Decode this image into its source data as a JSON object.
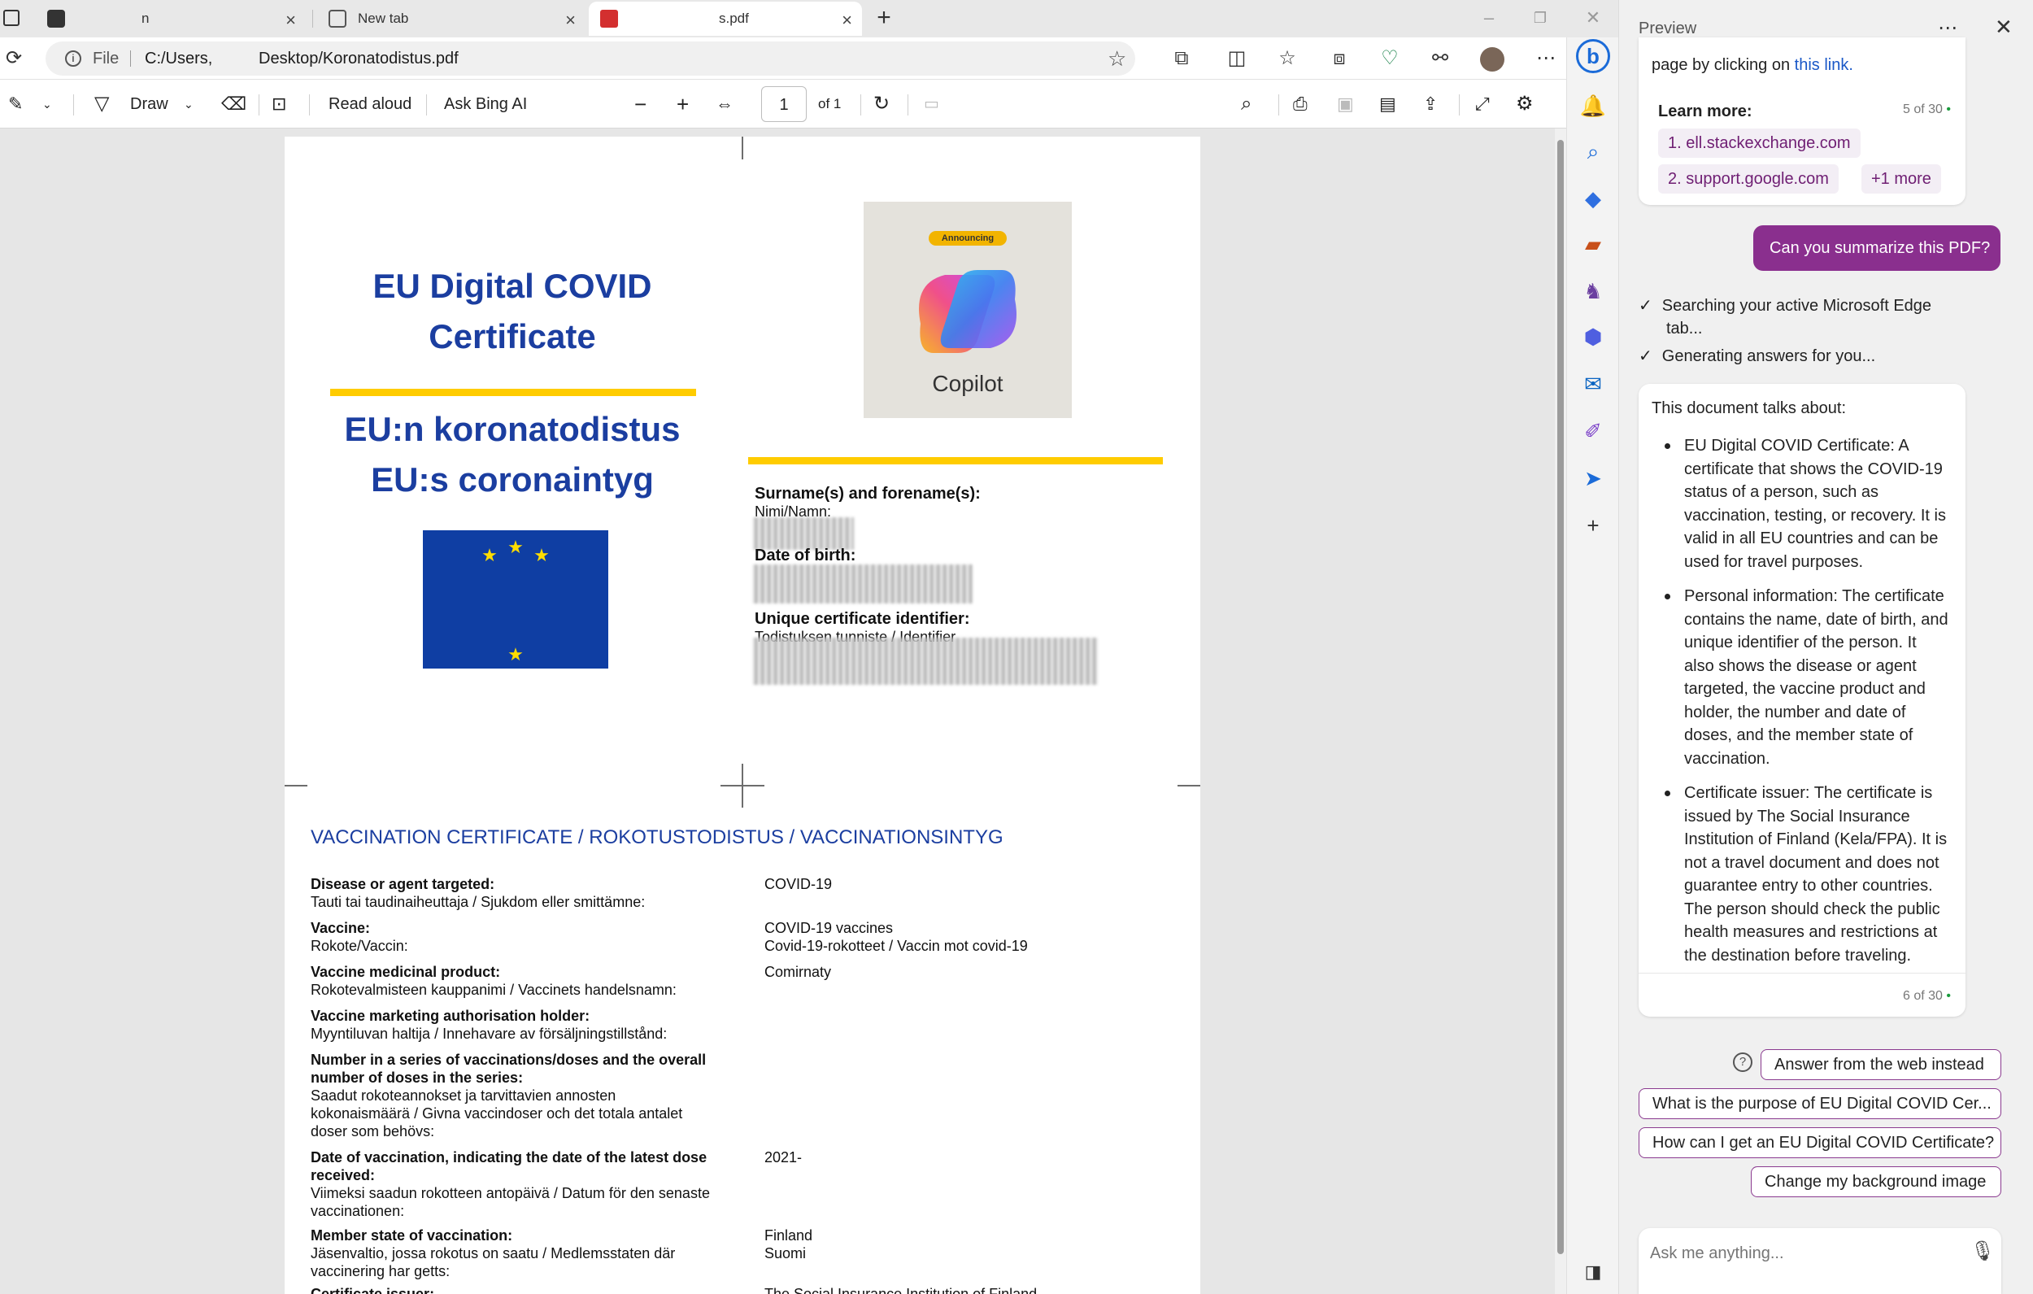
{
  "browser": {
    "tabs": [
      {
        "label": "n"
      },
      {
        "label": "New tab"
      },
      {
        "label": "s.pdf"
      }
    ],
    "address": {
      "scheme_label": "File",
      "path_start": "C:/Users,",
      "path_end": "Desktop/Koronatodistus.pdf"
    }
  },
  "pdf_toolbar": {
    "draw": "Draw",
    "read_aloud": "Read aloud",
    "ask_bing": "Ask Bing AI",
    "page_number": "1",
    "page_of": "of 1"
  },
  "pdf": {
    "title_line1": "EU Digital COVID",
    "title_line2": "Certificate",
    "fi_title": "EU:n koronatodistus",
    "sv_title": "EU:s coronaintyg",
    "copilot_badge": "Announcing",
    "copilot_label": "Copilot",
    "personal": {
      "surname_label": "Surname(s) and forename(s):",
      "surname_sub": "Nimi/Namn:",
      "dob_label": "Date of birth:",
      "uci_label": "Unique certificate identifier:",
      "uci_sub": "Todistuksen tunniste / Identifier"
    },
    "vaccination_header": "VACCINATION CERTIFICATE / ROKOTUSTODISTUS / VACCINATIONSINTYG",
    "rows": [
      {
        "label": "Disease or agent targeted:",
        "sub": "Tauti tai taudinaiheuttaja / Sjukdom eller smittämne:",
        "value": "COVID-19",
        "value2": ""
      },
      {
        "label": "Vaccine:",
        "sub": "Rokote/Vaccin:",
        "value": "COVID-19 vaccines",
        "value2": "Covid-19-rokotteet / Vaccin mot covid-19"
      },
      {
        "label": "Vaccine medicinal product:",
        "sub": "Rokotevalmisteen kauppanimi / Vaccinets handelsnamn:",
        "value": "Comirnaty",
        "value2": ""
      },
      {
        "label": "Vaccine marketing authorisation holder:",
        "sub": "Myyntiluvan haltija / Innehavare av försäljningstillstånd:",
        "value": "",
        "value2": ""
      },
      {
        "label": "Number in a series of vaccinations/doses and the overall",
        "label2": "number of doses in the series:",
        "sub": "Saadut rokoteannokset ja tarvittavien annosten",
        "sub2": "kokonaismäärä / Givna vaccindoser och det totala antalet",
        "sub3": "doser som behövs:",
        "value": "",
        "value2": ""
      },
      {
        "label": "Date of vaccination, indicating the date of the latest dose",
        "label2": "received:",
        "sub": "Viimeksi saadun rokotteen antopäivä / Datum för den senaste",
        "sub2": "vaccinationen:",
        "value": "2021-",
        "value2": ""
      },
      {
        "label": "Member state of vaccination:",
        "sub": "Jäsenvaltio, jossa rokotus on saatu / Medlemsstaten där",
        "sub2": "vaccinering har getts:",
        "value": "Finland",
        "value2": "Suomi"
      },
      {
        "label": "Certificate issuer:",
        "sub": "",
        "value": "The Social Insurance Institution of Finland",
        "value2": ""
      }
    ]
  },
  "copilot": {
    "header": "Preview",
    "prev_text": "page by clicking on",
    "prev_link": "this link.",
    "learn_more": "Learn more:",
    "counter1": "5 of 30",
    "sources": [
      "1. ell.stackexchange.com",
      "2. support.google.com",
      "+1 more"
    ],
    "user_msg": "Can you summarize this PDF?",
    "status1a": "Searching your active Microsoft Edge",
    "status1b": "tab...",
    "status2": "Generating answers for you...",
    "answer_intro": "This document talks about:",
    "bullets": [
      [
        "EU Digital COVID Certificate: A",
        "certificate that shows the COVID-19",
        "status of a person, such as",
        "vaccination, testing, or recovery. It is",
        "valid in all EU countries and can be",
        "used for travel purposes."
      ],
      [
        "Personal information: The certificate",
        "contains the name, date of birth, and",
        "unique identifier of the person. It",
        "also shows the disease or agent",
        "targeted, the vaccine product and",
        "holder, the number and date of",
        "doses, and the member state of",
        "vaccination."
      ],
      [
        "Certificate issuer: The certificate is",
        "issued by The Social Insurance",
        "Institution of Finland (Kela/FPA). It is",
        "not a travel document and does not",
        "guarantee entry to other countries.",
        "The person should check the public",
        "health measures and restrictions at",
        "the destination before traveling."
      ]
    ],
    "counter2": "6 of 30",
    "suggestions": [
      "Answer from the web instead",
      "What is the purpose of EU Digital COVID Cer...",
      "How can I get an EU Digital COVID Certificate?",
      "Change my background image"
    ],
    "input_placeholder": "Ask me anything..."
  },
  "colors": {
    "accent": "#8a2f8e",
    "doc_blue": "#1b3ea0",
    "yellow": "#ffcc00",
    "eu_blue": "#0f3ea3"
  }
}
